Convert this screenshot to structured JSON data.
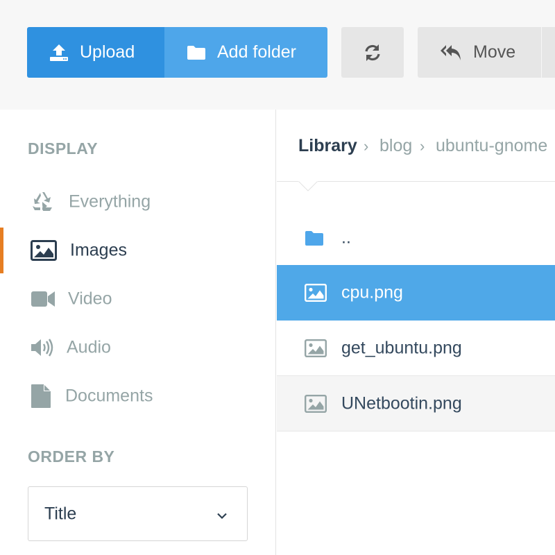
{
  "toolbar": {
    "upload_label": "Upload",
    "add_folder_label": "Add folder",
    "move_label": "Move"
  },
  "sidebar": {
    "display_title": "DISPLAY",
    "items": [
      {
        "label": "Everything",
        "icon": "recycle-icon"
      },
      {
        "label": "Images",
        "icon": "image-icon",
        "active": true
      },
      {
        "label": "Video",
        "icon": "video-camera-icon"
      },
      {
        "label": "Audio",
        "icon": "volume-icon"
      },
      {
        "label": "Documents",
        "icon": "file-icon"
      }
    ],
    "order_title": "ORDER BY",
    "order_value": "Title"
  },
  "breadcrumb": {
    "root": "Library",
    "parts": [
      "blog",
      "ubuntu-gnome"
    ]
  },
  "files": [
    {
      "name": "..",
      "type": "folder"
    },
    {
      "name": "cpu.png",
      "type": "image",
      "selected": true
    },
    {
      "name": "get_ubuntu.png",
      "type": "image"
    },
    {
      "name": "UNetbootin.png",
      "type": "image"
    }
  ],
  "colors": {
    "primary": "#2f91e0",
    "primary_light": "#4ea6ea",
    "selected_row": "#4fa8e8",
    "active_accent": "#e67e22",
    "muted_text": "#95a5a6",
    "dark_text": "#2c3e50"
  }
}
